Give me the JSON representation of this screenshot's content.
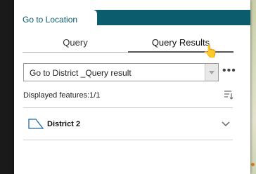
{
  "window": {
    "title": "Go to Location"
  },
  "tabs": [
    {
      "label": "Query",
      "active": false
    },
    {
      "label": "Query Results",
      "active": true
    }
  ],
  "select": {
    "value": "Go to District _Query result"
  },
  "features": {
    "label": "Displayed features:1/1"
  },
  "results": [
    {
      "label": "District 2"
    }
  ],
  "icons": {
    "more": "more-icon",
    "sort": "sort-icon",
    "polygon": "polygon-icon",
    "chevron": "chevron-down-icon",
    "cursor": "hand-cursor-icon"
  },
  "colors": {
    "header": "#0b5d6e",
    "polygon_stroke": "#1f6aa5"
  }
}
